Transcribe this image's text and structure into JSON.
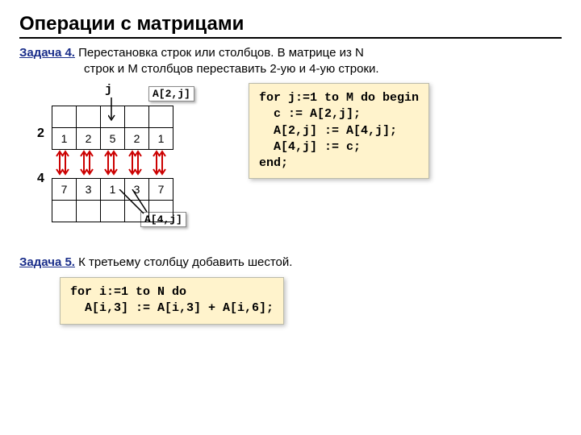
{
  "title": "Операции с матрицами",
  "task4": {
    "label": "Задача 4.",
    "line1": " Перестановка строк или столбцов. В матрице из N",
    "line2": "строк и M столбцов переставить 2-ую и 4-ую строки."
  },
  "matrix": {
    "j_label": "j",
    "a2j": "A[2,j]",
    "a4j": "A[4,j]",
    "row_labels": {
      "r2": "2",
      "r4": "4"
    },
    "row2": [
      "1",
      "2",
      "5",
      "2",
      "1"
    ],
    "row4": [
      "7",
      "3",
      "1",
      "3",
      "7"
    ]
  },
  "code4": {
    "l1": "for j:=1 to M do begin",
    "l2": "  c := A[2,j];",
    "l3": "  A[2,j] := A[4,j];",
    "l4": "  A[4,j] := c;",
    "l5": "end;"
  },
  "task5": {
    "label": "Задача 5.",
    "text": " К третьему столбцу добавить шестой."
  },
  "code5": {
    "l1": "for i:=1 to N do",
    "l2": "  A[i,3] := A[i,3] + A[i,6];"
  }
}
